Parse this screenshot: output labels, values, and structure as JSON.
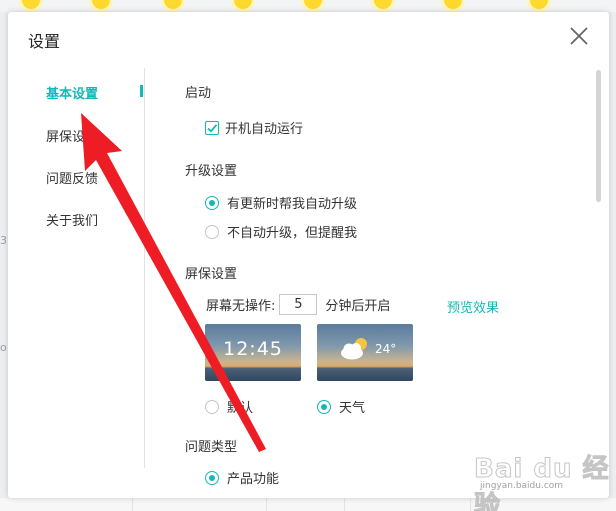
{
  "dialog": {
    "title": "设置"
  },
  "sidebar": {
    "items": [
      {
        "label": "基本设置",
        "active": true
      },
      {
        "label": "屏保设"
      },
      {
        "label": "问题反馈"
      },
      {
        "label": "关于我们"
      }
    ]
  },
  "startup": {
    "title": "启动",
    "autorun_label": "开机自动运行",
    "autorun_checked": true
  },
  "upgrade": {
    "title": "升级设置",
    "options": [
      {
        "label": "有更新时帮我自动升级",
        "selected": true
      },
      {
        "label": "不自动升级，但提醒我",
        "selected": false
      }
    ]
  },
  "screensaver": {
    "title": "屏保设置",
    "idle_prefix": "屏幕无操作:",
    "idle_value": "5",
    "idle_suffix": "分钟后开启",
    "preview_label": "预览效果",
    "themes": [
      {
        "label": "默认",
        "selected": false,
        "preview_text": "12:45"
      },
      {
        "label": "天气",
        "selected": true,
        "preview_text": "24°"
      }
    ]
  },
  "feedback": {
    "title": "问题类型",
    "options": [
      {
        "label": "产品功能",
        "selected": true
      }
    ]
  },
  "background": {
    "left_fragments": [
      "3",
      "o"
    ]
  },
  "watermark": {
    "logo_text": "Bai du 经验",
    "url_text": "jingyan.baidu.com"
  },
  "colors": {
    "accent": "#14b8b8",
    "arrow": "#ee1c24"
  },
  "icons": {
    "close": "close-icon",
    "check": "check-icon",
    "weather": "cloud-sun-icon"
  }
}
